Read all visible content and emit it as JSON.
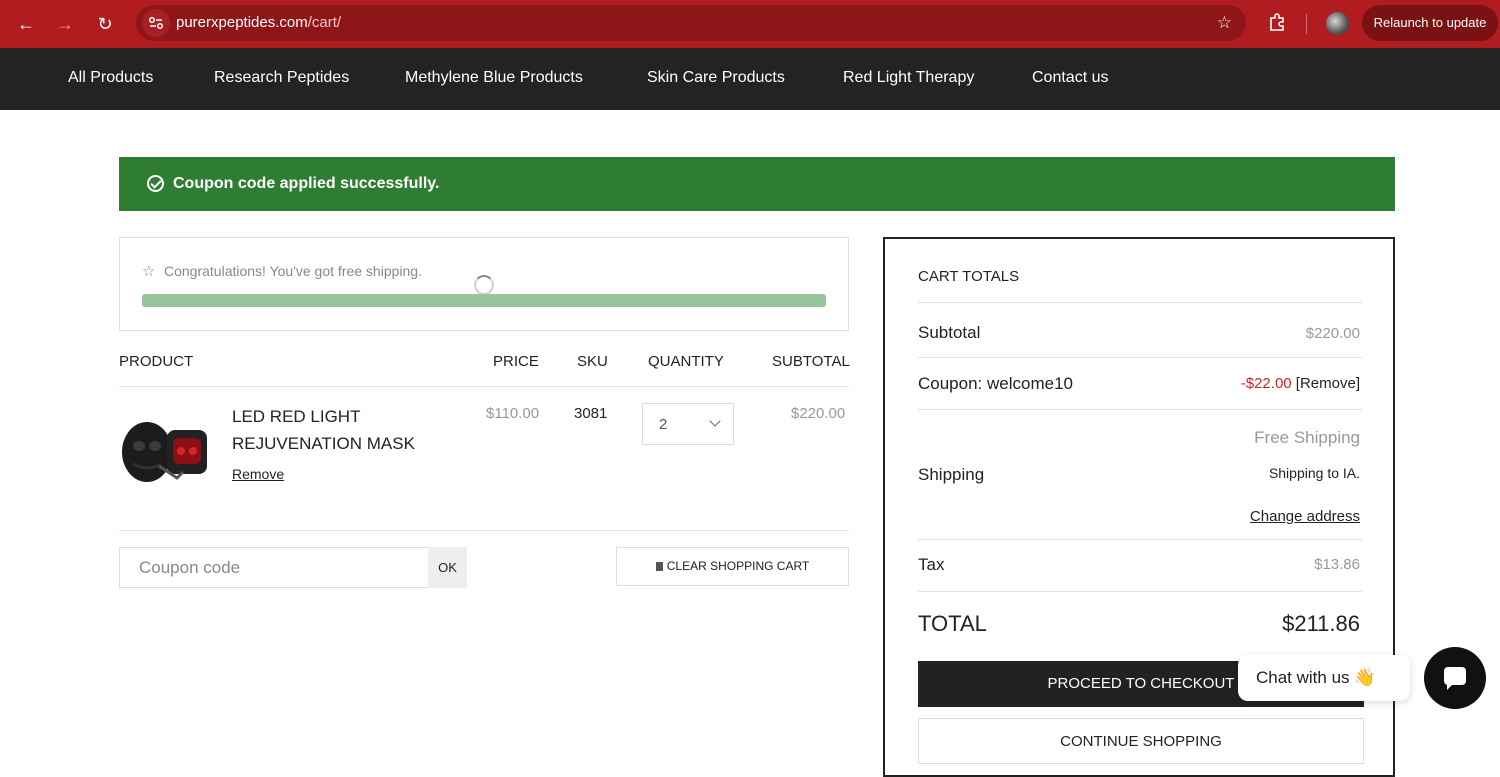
{
  "browser": {
    "url_domain": "purerxpeptides.com",
    "url_path": "/cart/",
    "relaunch_label": "Relaunch to update"
  },
  "nav": {
    "items": [
      "All Products",
      "Research Peptides",
      "Methylene Blue Products",
      "Skin Care Products",
      "Red Light Therapy",
      "Contact us"
    ]
  },
  "notice": {
    "message": "Coupon code applied successfully."
  },
  "free_shipping": {
    "message": "Congratulations! You've got free shipping.",
    "progress": 1.0
  },
  "cart": {
    "headers": {
      "product": "PRODUCT",
      "price": "PRICE",
      "sku": "SKU",
      "quantity": "QUANTITY",
      "subtotal": "SUBTOTAL"
    },
    "items": [
      {
        "name": "LED RED LIGHT REJUVENATION MASK",
        "remove_label": "Remove",
        "price": "$110.00",
        "sku": "3081",
        "quantity": "2",
        "subtotal": "$220.00"
      }
    ],
    "coupon_placeholder": "Coupon code",
    "ok_label": "OK",
    "clear_label": "CLEAR SHOPPING CART"
  },
  "totals": {
    "heading": "CART TOTALS",
    "subtotal_label": "Subtotal",
    "subtotal_value": "$220.00",
    "coupon_label": "Coupon: welcome10",
    "coupon_discount": "-$22.00",
    "coupon_remove": "[Remove]",
    "shipping_label": "Shipping",
    "shipping_method": "Free Shipping",
    "shipping_to": "Shipping to IA.",
    "change_address": "Change address",
    "tax_label": "Tax",
    "tax_value": "$13.86",
    "total_label": "TOTAL",
    "total_value": "$211.86",
    "checkout_label": "PROCEED TO CHECKOUT",
    "continue_label": "CONTINUE SHOPPING"
  },
  "chat": {
    "label": "Chat with us",
    "emoji": "👋"
  },
  "colors": {
    "chrome": "#b01c1f",
    "nav": "#232323",
    "success": "#2f7d32",
    "discount": "#c62828"
  }
}
